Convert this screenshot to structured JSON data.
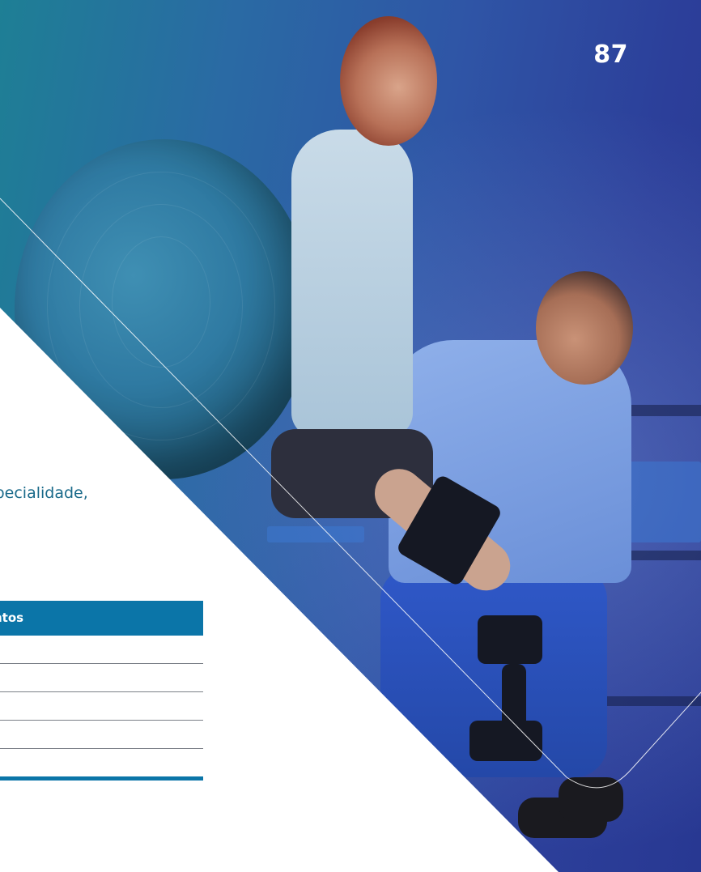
{
  "page": {
    "number": "87"
  },
  "content": {
    "body_text": "especialidade,"
  },
  "table": {
    "header_text": "ntos",
    "row_count": 5,
    "accent_color": "#0b75a8"
  },
  "photo": {
    "description_icon": "physiotherapy-photo"
  },
  "colors": {
    "brand_blue": "#0b75a8",
    "text_teal": "#1a6a8a",
    "overlay_deep": "#283892"
  }
}
